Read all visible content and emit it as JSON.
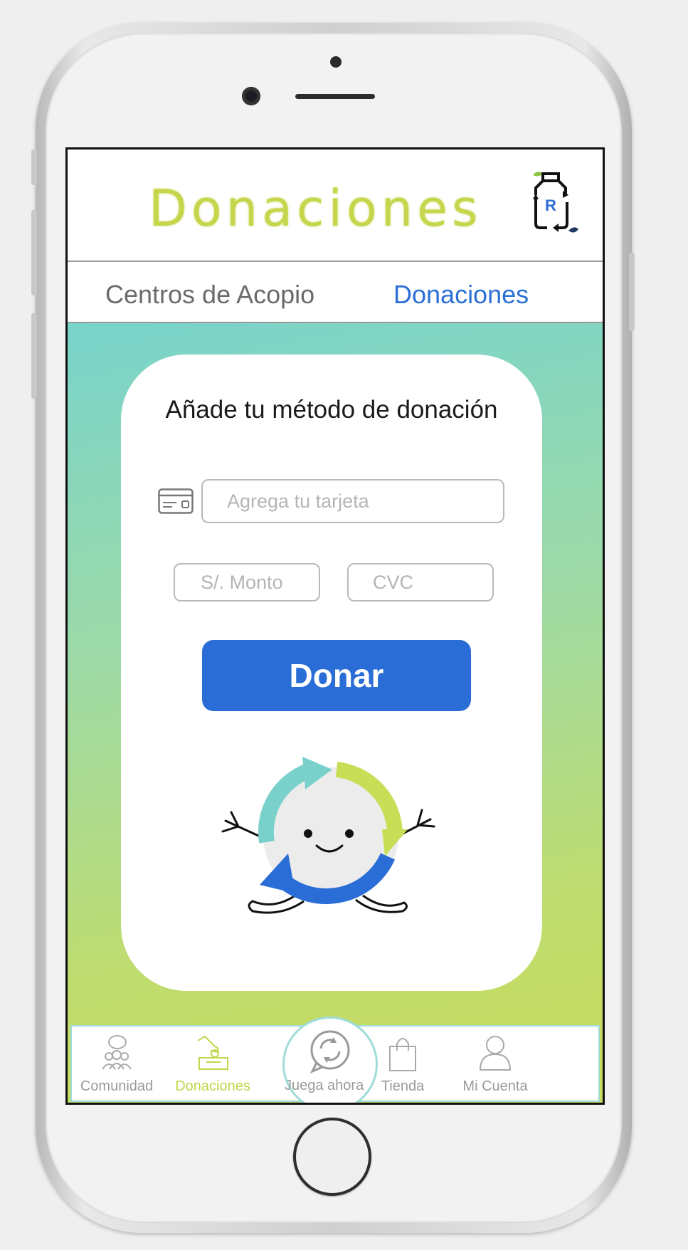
{
  "header": {
    "title": "Donaciones",
    "logo_letter": "R"
  },
  "tabs": [
    {
      "label": "Centros de Acopio",
      "active": false
    },
    {
      "label": "Donaciones",
      "active": true
    }
  ],
  "form": {
    "title": "Añade tu método de donación",
    "card_placeholder": "Agrega tu tarjeta",
    "amount_placeholder": "S/. Monto",
    "cvc_placeholder": "CVC",
    "submit_label": "Donar"
  },
  "bottom_nav": [
    {
      "label": "Comunidad",
      "icon": "community-icon",
      "active": false
    },
    {
      "label": "Donaciones",
      "icon": "donation-icon",
      "active": true
    },
    {
      "label": "Juega ahora",
      "icon": "recycle-chat-icon",
      "active": false
    },
    {
      "label": "Tienda",
      "icon": "shopping-bag-icon",
      "active": false
    },
    {
      "label": "Mi Cuenta",
      "icon": "user-icon",
      "active": false
    }
  ],
  "colors": {
    "title_green": "#c6d64c",
    "tab_active": "#2c6fd6",
    "button_blue": "#2a6dd6",
    "nav_active": "#c3d64a",
    "nav_border": "#9fdcd7"
  }
}
